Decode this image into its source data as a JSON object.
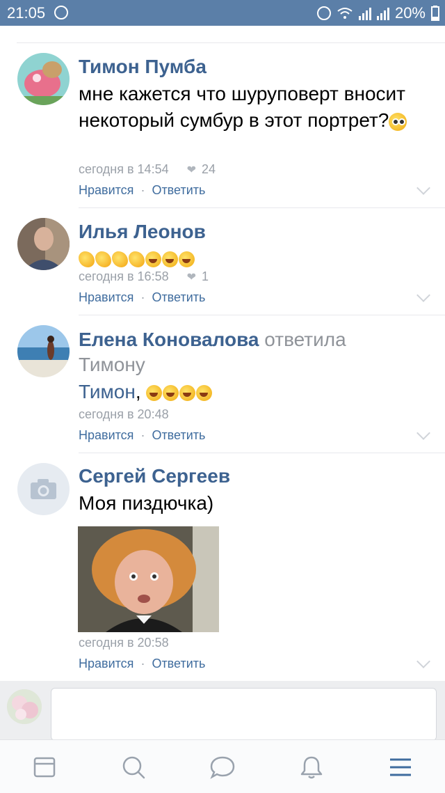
{
  "status_bar": {
    "time": "21:05",
    "battery": "20%"
  },
  "comments": [
    {
      "name": "Тимон Пумба",
      "text": "мне кажется что шуруповерт вносит некоторый сумбур в этот портрет?",
      "time": "сегодня в 14:54",
      "likes": "24",
      "like_label": "Нравится",
      "reply_label": "Ответить"
    },
    {
      "name": "Илья Леонов",
      "time": "сегодня в 16:58",
      "likes": "1",
      "like_label": "Нравится",
      "reply_label": "Ответить"
    },
    {
      "name": "Елена Коновалова",
      "reply_to": "ответила Тимону",
      "mention": "Тимон",
      "text_suffix": ",",
      "time": "сегодня в 20:48",
      "like_label": "Нравится",
      "reply_label": "Ответить"
    },
    {
      "name": "Сергей Сергеев",
      "text": "Моя пиздючка)",
      "time": "сегодня в 20:58",
      "like_label": "Нравится",
      "reply_label": "Ответить"
    }
  ],
  "composer": {
    "placeholder": ""
  },
  "tabs": [
    "news-icon",
    "search-icon",
    "messages-icon",
    "notifications-icon",
    "menu-icon"
  ],
  "colors": {
    "status_bar": "#5b7fa8",
    "name": "#3d6290",
    "link": "#3f6c9e",
    "meta": "#9aa0a8",
    "menu_active": "#3f6c9e",
    "tab_icon": "#99a2ad"
  }
}
